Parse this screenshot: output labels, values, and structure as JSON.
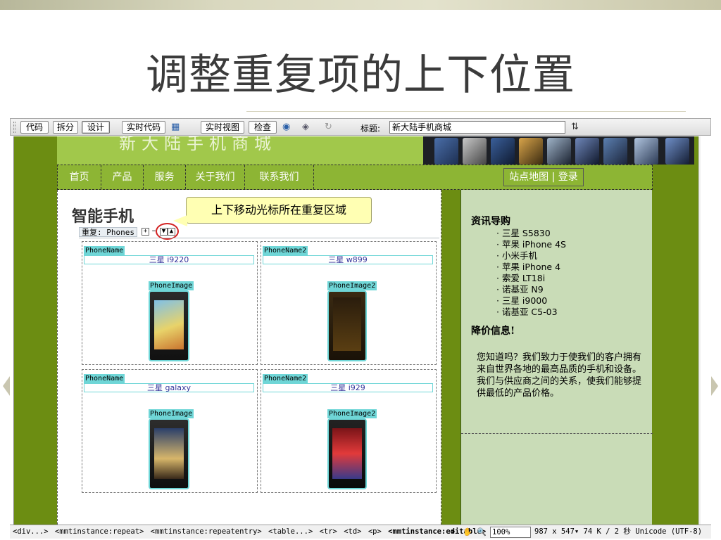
{
  "slide": {
    "title": "调整重复项的上下位置"
  },
  "toolbar": {
    "view_buttons": [
      "代码",
      "拆分",
      "设计",
      "实时代码"
    ],
    "live_buttons": [
      "实时视图",
      "检查"
    ],
    "title_label": "标题:",
    "title_value": "新大陆手机商城"
  },
  "page": {
    "banner_text": "新大陆手机商城",
    "nav": [
      "首页",
      "产品",
      "服务",
      "关于我们",
      "联系我们"
    ],
    "nav_right": "站点地图 | 登录",
    "section_title": "智能手机",
    "repeat_label": "重复: Phones",
    "repeat_controls": [
      "+",
      "−",
      "▼",
      "▲"
    ],
    "callout": "上下移动光标所在重复区域",
    "cells": [
      {
        "name_tag": "PhoneName",
        "name": "三星 i9220",
        "image_tag": "PhoneImage"
      },
      {
        "name_tag": "PhoneName2",
        "name": "三星 w899",
        "image_tag": "PhoneImage2"
      },
      {
        "name_tag": "PhoneName",
        "name": "三星 galaxy",
        "image_tag": "PhoneImage"
      },
      {
        "name_tag": "PhoneName2",
        "name": "三星 i929",
        "image_tag": "PhoneImage2"
      }
    ]
  },
  "sidebar": {
    "heading1": "资讯导购",
    "items": [
      "三星 S5830",
      "苹果 iPhone 4S",
      "小米手机",
      "苹果 iPhone 4",
      "索爱 LT18i",
      "诺基亚 N9",
      "三星 i9000",
      "诺基亚 C5-03"
    ],
    "heading2": "降价信息!",
    "text": "您知道吗？我们致力于使我们的客户拥有来自世界各地的最高品质的手机和设备。我们与供应商之间的关系，使我们能够提供最低的产品价格。"
  },
  "status": {
    "tag_path": [
      "<div...>",
      "<mmtinstance:repeat>",
      "<mmtinstance:repeatentry>",
      "<table...>",
      "<tr>",
      "<td>",
      "<p>",
      "<mmtinstance:editable>"
    ],
    "zoom": "100%",
    "info": "987 x 547▾ 74 K / 2 秒 Unicode (UTF-8)"
  }
}
